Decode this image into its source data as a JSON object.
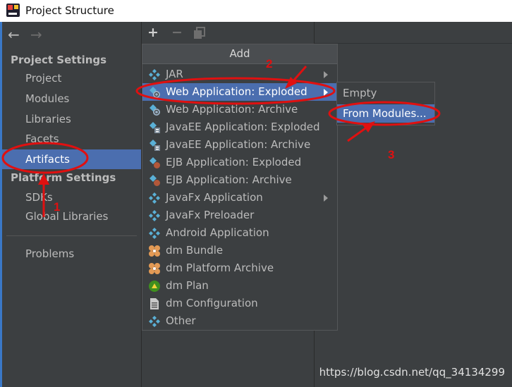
{
  "window": {
    "title": "Project Structure"
  },
  "nav": {
    "back_icon": "arrow-left-icon",
    "forward_icon": "arrow-right-icon"
  },
  "sidebar": {
    "project_settings_heading": "Project Settings",
    "project_items": [
      "Project",
      "Modules",
      "Libraries",
      "Facets",
      "Artifacts"
    ],
    "selected_item": "Artifacts",
    "platform_settings_heading": "Platform Settings",
    "platform_items": [
      "SDKs",
      "Global Libraries"
    ],
    "other_items": [
      "Problems"
    ]
  },
  "toolbar": {
    "add_label": "+",
    "remove_label": "−"
  },
  "add_menu": {
    "title": "Add",
    "items": [
      {
        "label": "JAR",
        "icon": "artifact-icon",
        "submenu": true
      },
      {
        "label": "Web Application: Exploded",
        "icon": "web-app-icon",
        "submenu": true,
        "highlighted": true
      },
      {
        "label": "Web Application: Archive",
        "icon": "web-app-icon",
        "submenu": false
      },
      {
        "label": "JavaEE Application: Exploded",
        "icon": "javaee-icon",
        "submenu": false
      },
      {
        "label": "JavaEE Application: Archive",
        "icon": "javaee-icon",
        "submenu": false
      },
      {
        "label": "EJB Application: Exploded",
        "icon": "ejb-icon",
        "submenu": false
      },
      {
        "label": "EJB Application: Archive",
        "icon": "ejb-icon",
        "submenu": false
      },
      {
        "label": "JavaFx Application",
        "icon": "artifact-icon",
        "submenu": true
      },
      {
        "label": "JavaFx Preloader",
        "icon": "artifact-icon",
        "submenu": false
      },
      {
        "label": "Android Application",
        "icon": "artifact-icon",
        "submenu": false
      },
      {
        "label": "dm Bundle",
        "icon": "bundle-icon",
        "submenu": false
      },
      {
        "label": "dm Platform Archive",
        "icon": "bundle-icon",
        "submenu": false
      },
      {
        "label": "dm Plan",
        "icon": "plan-icon",
        "submenu": false
      },
      {
        "label": "dm Configuration",
        "icon": "document-icon",
        "submenu": false
      },
      {
        "label": "Other",
        "icon": "artifact-icon",
        "submenu": false
      }
    ]
  },
  "submenu": {
    "items": [
      {
        "label": "Empty",
        "highlighted": false
      },
      {
        "label": "From Modules...",
        "highlighted": true
      }
    ]
  },
  "annotations": {
    "step1": "1",
    "step2": "2",
    "step3": "3",
    "color": "#e01010"
  },
  "watermark": "https://blog.csdn.net/qq_34134299",
  "colors": {
    "background": "#3c3f41",
    "selection": "#4b6eaf",
    "text": "#bbbbbb",
    "annotation": "#e01010"
  }
}
